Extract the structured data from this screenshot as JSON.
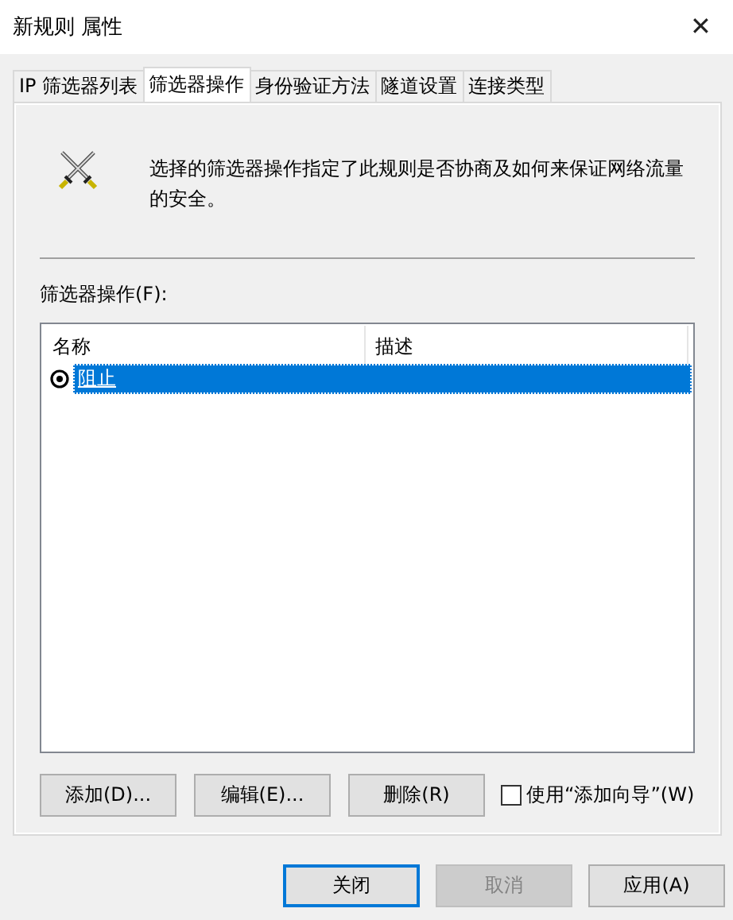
{
  "window": {
    "title": "新规则 属性",
    "close": "✕"
  },
  "tabs": [
    {
      "label": "IP 筛选器列表",
      "selected": false
    },
    {
      "label": "筛选器操作",
      "selected": true
    },
    {
      "label": "身份验证方法",
      "selected": false
    },
    {
      "label": "隧道设置",
      "selected": false
    },
    {
      "label": "连接类型",
      "selected": false
    }
  ],
  "description": "选择的筛选器操作指定了此规则是否协商及如何来保证网络流量的安全。",
  "list": {
    "label": "筛选器操作(F):",
    "columns": [
      "名称",
      "描述"
    ],
    "rows": [
      {
        "name": "阻止",
        "description": "",
        "selected": true,
        "active": true
      }
    ]
  },
  "actions": [
    {
      "label": "添加(D)...",
      "disabled": false
    },
    {
      "label": "编辑(E)...",
      "disabled": false
    },
    {
      "label": "删除(R)",
      "disabled": false
    }
  ],
  "wizard": {
    "label": "使用“添加向导”(W)",
    "checked": false
  },
  "buttons": [
    {
      "label": "关闭",
      "default": true,
      "disabled": false
    },
    {
      "label": "取消",
      "default": false,
      "disabled": true
    },
    {
      "label": "应用(A)",
      "default": false,
      "disabled": false
    }
  ]
}
